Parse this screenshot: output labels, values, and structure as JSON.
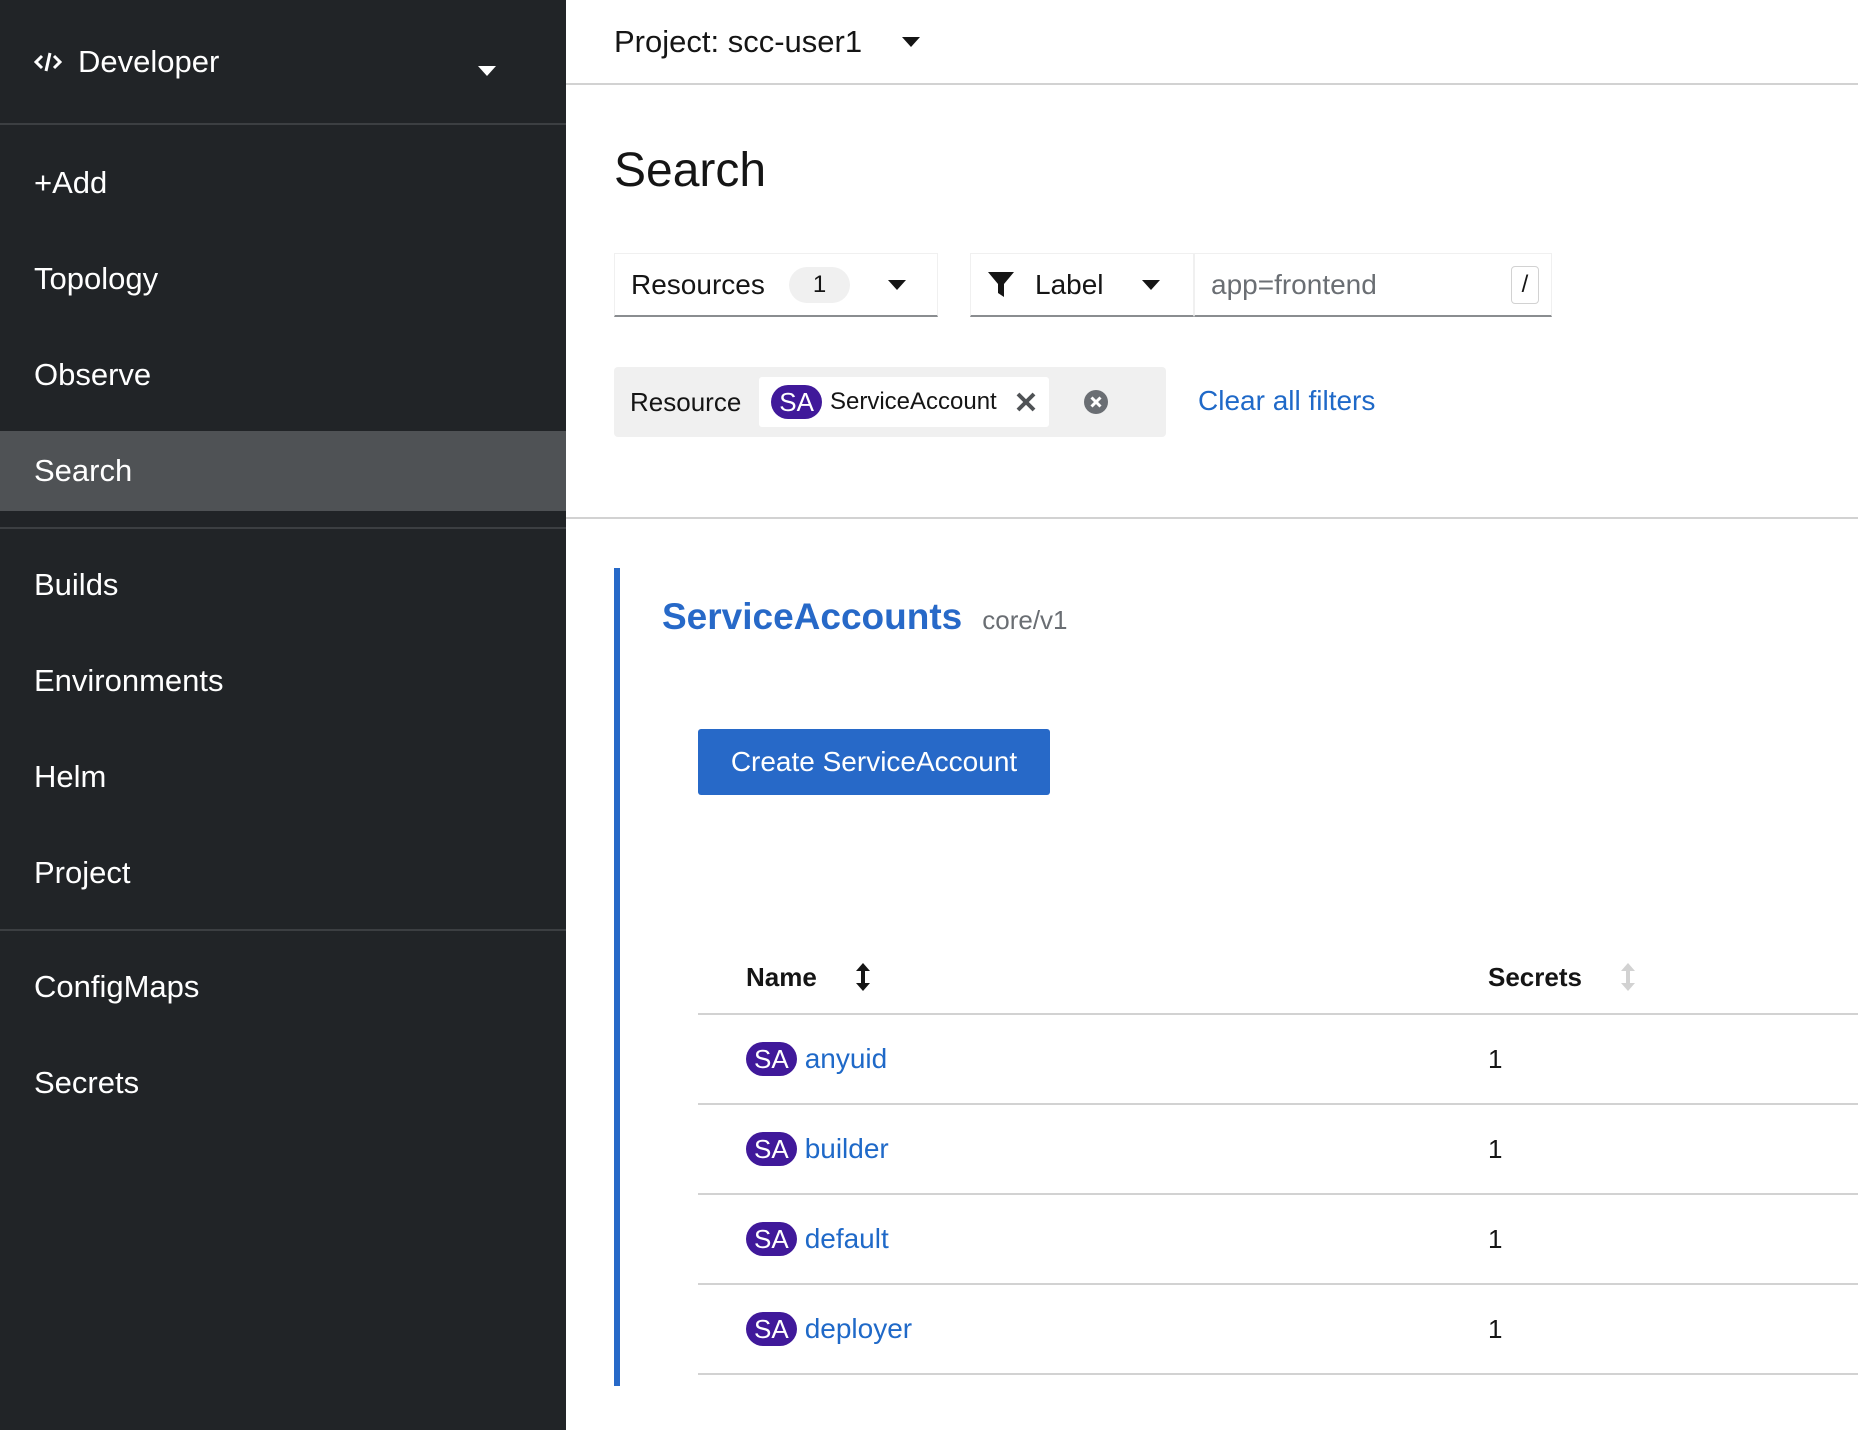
{
  "sidebar": {
    "perspective": "Developer",
    "groups": [
      [
        {
          "label": "+Add"
        },
        {
          "label": "Topology"
        },
        {
          "label": "Observe"
        },
        {
          "label": "Search"
        }
      ],
      [
        {
          "label": "Builds"
        },
        {
          "label": "Environments"
        },
        {
          "label": "Helm"
        },
        {
          "label": "Project"
        }
      ],
      [
        {
          "label": "ConfigMaps"
        },
        {
          "label": "Secrets"
        }
      ]
    ],
    "active": "Search"
  },
  "header": {
    "project_label": "Project: scc-user1"
  },
  "page": {
    "title": "Search",
    "resources_dropdown": {
      "label": "Resources",
      "count": "1"
    },
    "filter_dropdown": {
      "label": "Label"
    },
    "search_input": {
      "value": "app=frontend",
      "shortcut": "/"
    },
    "chip_group": {
      "category": "Resource",
      "chip_badge": "SA",
      "chip_label": "ServiceAccount"
    },
    "clear_all": "Clear all filters"
  },
  "section": {
    "title": "ServiceAccounts",
    "api_version": "core/v1",
    "create_button": "Create ServiceAccount",
    "columns": [
      "Name",
      "Secrets"
    ],
    "rows": [
      {
        "badge": "SA",
        "name": "anyuid",
        "secrets": "1"
      },
      {
        "badge": "SA",
        "name": "builder",
        "secrets": "1"
      },
      {
        "badge": "SA",
        "name": "default",
        "secrets": "1"
      },
      {
        "badge": "SA",
        "name": "deployer",
        "secrets": "1"
      }
    ]
  },
  "colors": {
    "sidebar_bg": "#212427",
    "active_nav": "#4f5255",
    "link_blue": "#1f69c8",
    "primary_btn": "#2769c8",
    "sa_badge": "#40199a"
  }
}
